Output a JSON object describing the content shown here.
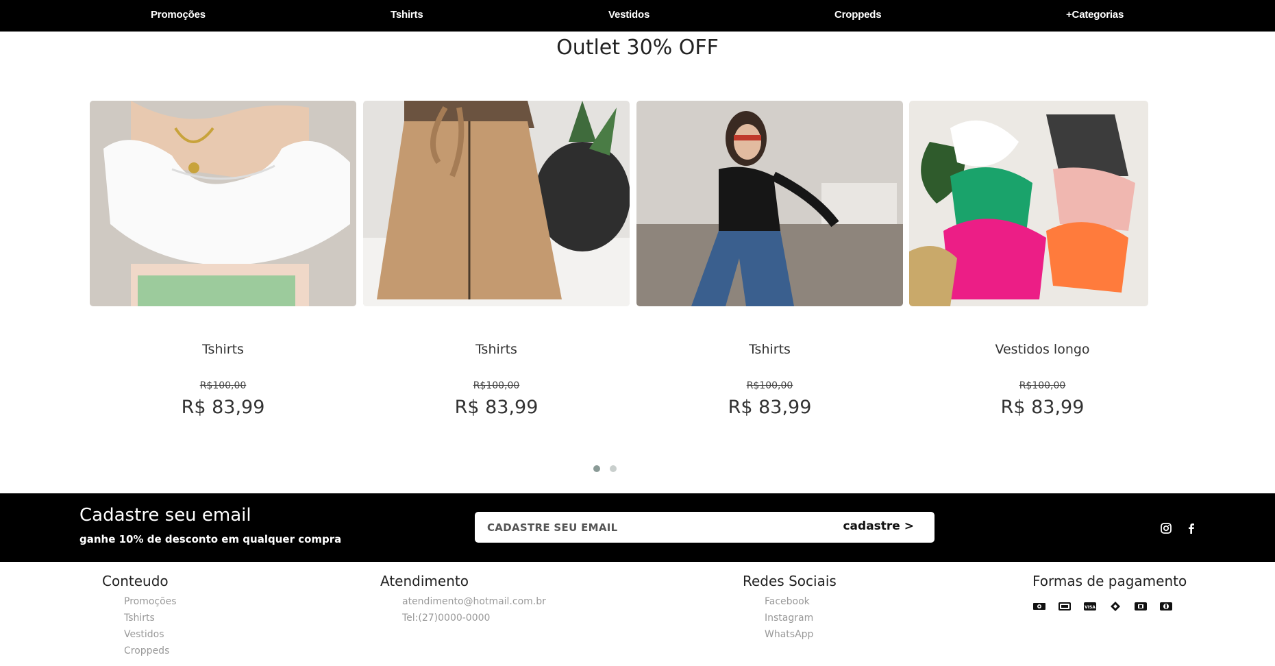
{
  "nav": {
    "items": [
      "Promoções",
      "Tshirts",
      "Vestidos",
      "Croppeds",
      "+Categorias"
    ]
  },
  "section": {
    "title": "Outlet 30% OFF"
  },
  "products": [
    {
      "name": "Tshirts",
      "old_price": "R$100,00",
      "price": "R$ 83,99"
    },
    {
      "name": "Tshirts",
      "old_price": "R$100,00",
      "price": "R$ 83,99"
    },
    {
      "name": "Tshirts",
      "old_price": "R$100,00",
      "price": "R$ 83,99"
    },
    {
      "name": "Vestidos longo",
      "old_price": "R$100,00",
      "price": "R$ 83,99"
    }
  ],
  "carousel": {
    "pages": 2,
    "active": 0
  },
  "newsletter": {
    "title": "Cadastre seu email",
    "subtitle": "ganhe 10% de desconto em qualquer compra",
    "placeholder": "CADASTRE SEU EMAIL",
    "button_label": "cadastre >",
    "social_icons": [
      "instagram-icon",
      "facebook-icon"
    ]
  },
  "footer": {
    "conteudo": {
      "title": "Conteudo",
      "links": [
        "Promoções",
        "Tshirts",
        "Vestidos",
        "Croppeds"
      ]
    },
    "atendimento": {
      "title": "Atendimento",
      "links": [
        "atendimento@hotmail.com.br",
        "Tel:(27)0000-0000"
      ]
    },
    "redes": {
      "title": "Redes Sociais",
      "links": [
        "Facebook",
        "Instagram",
        "WhatsApp"
      ]
    },
    "pagamento": {
      "title": "Formas de pagamento",
      "icons": [
        "cash-icon",
        "card-icon",
        "visa-icon",
        "pix-icon",
        "amex-icon",
        "diners-icon"
      ]
    }
  },
  "colors": {
    "nav_bg": "#000000",
    "dot_active": "#8a9a96",
    "dot_inactive": "#c9cfcd"
  }
}
